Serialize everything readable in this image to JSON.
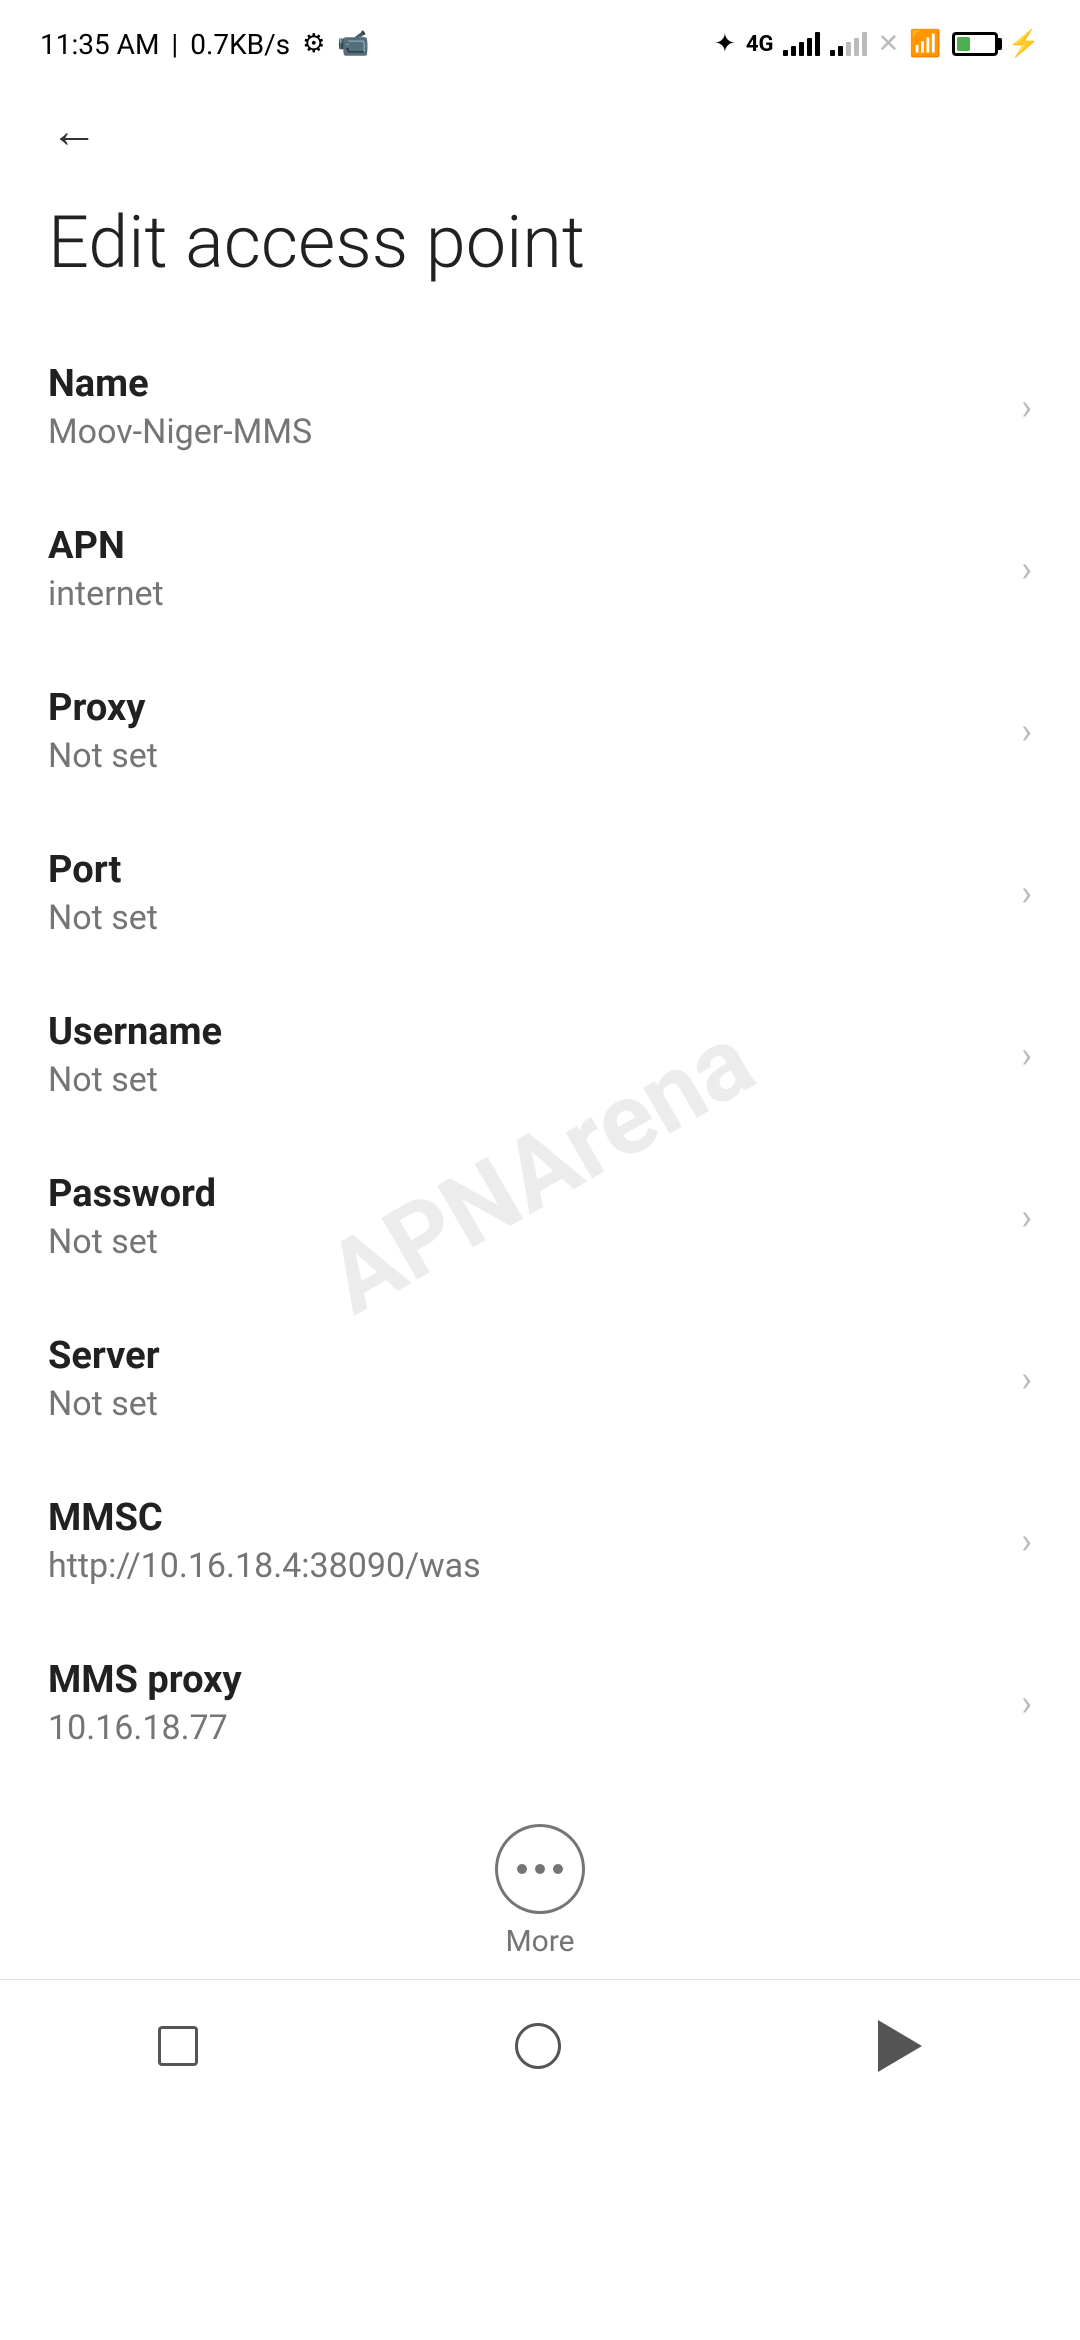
{
  "statusBar": {
    "time": "11:35 AM",
    "speed": "0.7KB/s"
  },
  "toolbar": {
    "backLabel": "←"
  },
  "page": {
    "title": "Edit access point"
  },
  "settings": [
    {
      "id": "name",
      "label": "Name",
      "value": "Moov-Niger-MMS"
    },
    {
      "id": "apn",
      "label": "APN",
      "value": "internet"
    },
    {
      "id": "proxy",
      "label": "Proxy",
      "value": "Not set"
    },
    {
      "id": "port",
      "label": "Port",
      "value": "Not set"
    },
    {
      "id": "username",
      "label": "Username",
      "value": "Not set"
    },
    {
      "id": "password",
      "label": "Password",
      "value": "Not set"
    },
    {
      "id": "server",
      "label": "Server",
      "value": "Not set"
    },
    {
      "id": "mmsc",
      "label": "MMSC",
      "value": "http://10.16.18.4:38090/was"
    },
    {
      "id": "mms-proxy",
      "label": "MMS proxy",
      "value": "10.16.18.77"
    }
  ],
  "more": {
    "label": "More"
  },
  "watermark": "APNArena"
}
